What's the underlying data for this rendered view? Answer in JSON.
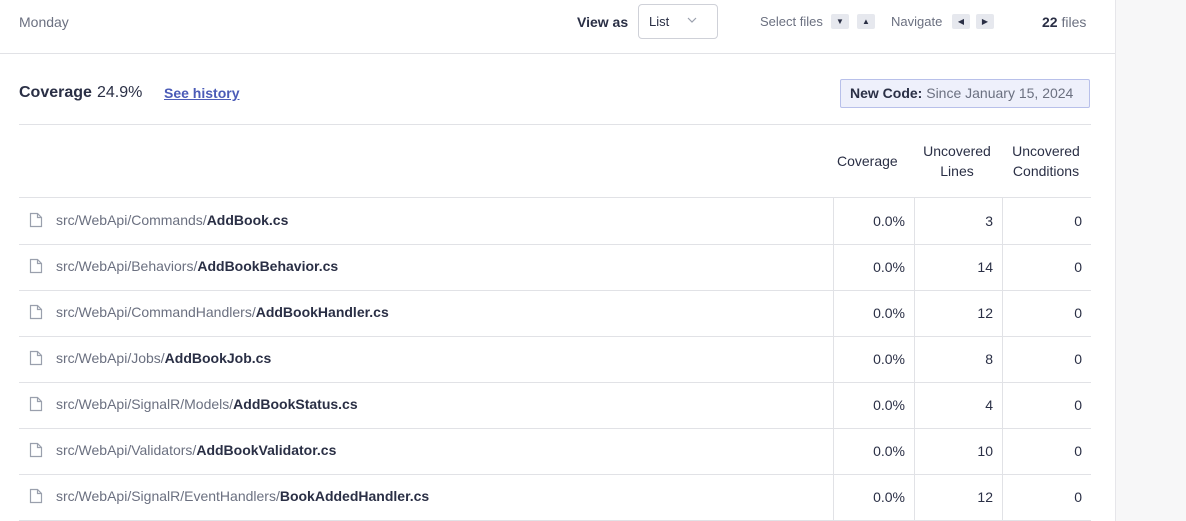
{
  "header": {
    "day": "Monday",
    "view_as_label": "View as",
    "view_as_value": "List",
    "select_files_label": "Select files",
    "navigate_label": "Navigate",
    "file_count_number": "22",
    "file_count_unit": "files"
  },
  "summary": {
    "coverage_label": "Coverage",
    "coverage_value": "24.9%",
    "see_history": "See history",
    "new_code_label": "New Code:",
    "new_code_value": "Since January 15, 2024"
  },
  "table": {
    "columns": {
      "coverage": "Coverage",
      "uncovered_lines_1": "Uncovered",
      "uncovered_lines_2": "Lines",
      "uncovered_conditions_1": "Uncovered",
      "uncovered_conditions_2": "Conditions"
    },
    "rows": [
      {
        "dir": "src/WebApi/Commands/",
        "file": "AddBook.cs",
        "coverage": "0.0%",
        "lines": "3",
        "conditions": "0"
      },
      {
        "dir": "src/WebApi/Behaviors/",
        "file": "AddBookBehavior.cs",
        "coverage": "0.0%",
        "lines": "14",
        "conditions": "0"
      },
      {
        "dir": "src/WebApi/CommandHandlers/",
        "file": "AddBookHandler.cs",
        "coverage": "0.0%",
        "lines": "12",
        "conditions": "0"
      },
      {
        "dir": "src/WebApi/Jobs/",
        "file": "AddBookJob.cs",
        "coverage": "0.0%",
        "lines": "8",
        "conditions": "0"
      },
      {
        "dir": "src/WebApi/SignalR/Models/",
        "file": "AddBookStatus.cs",
        "coverage": "0.0%",
        "lines": "4",
        "conditions": "0"
      },
      {
        "dir": "src/WebApi/Validators/",
        "file": "AddBookValidator.cs",
        "coverage": "0.0%",
        "lines": "10",
        "conditions": "0"
      },
      {
        "dir": "src/WebApi/SignalR/EventHandlers/",
        "file": "BookAddedHandler.cs",
        "coverage": "0.0%",
        "lines": "12",
        "conditions": "0"
      }
    ]
  },
  "icons": {
    "file": "file-icon",
    "chevron": "chevron-down-icon",
    "arrow_down": "arrow-down-icon",
    "arrow_up": "arrow-up-icon",
    "arrow_left": "arrow-left-icon",
    "arrow_right": "arrow-right-icon"
  },
  "colors": {
    "link": "#4b5bb7",
    "new_code_bg": "#eef0fb",
    "new_code_border": "#b8c0ea",
    "text_primary": "#2a2f45",
    "text_secondary": "#6b7080"
  }
}
